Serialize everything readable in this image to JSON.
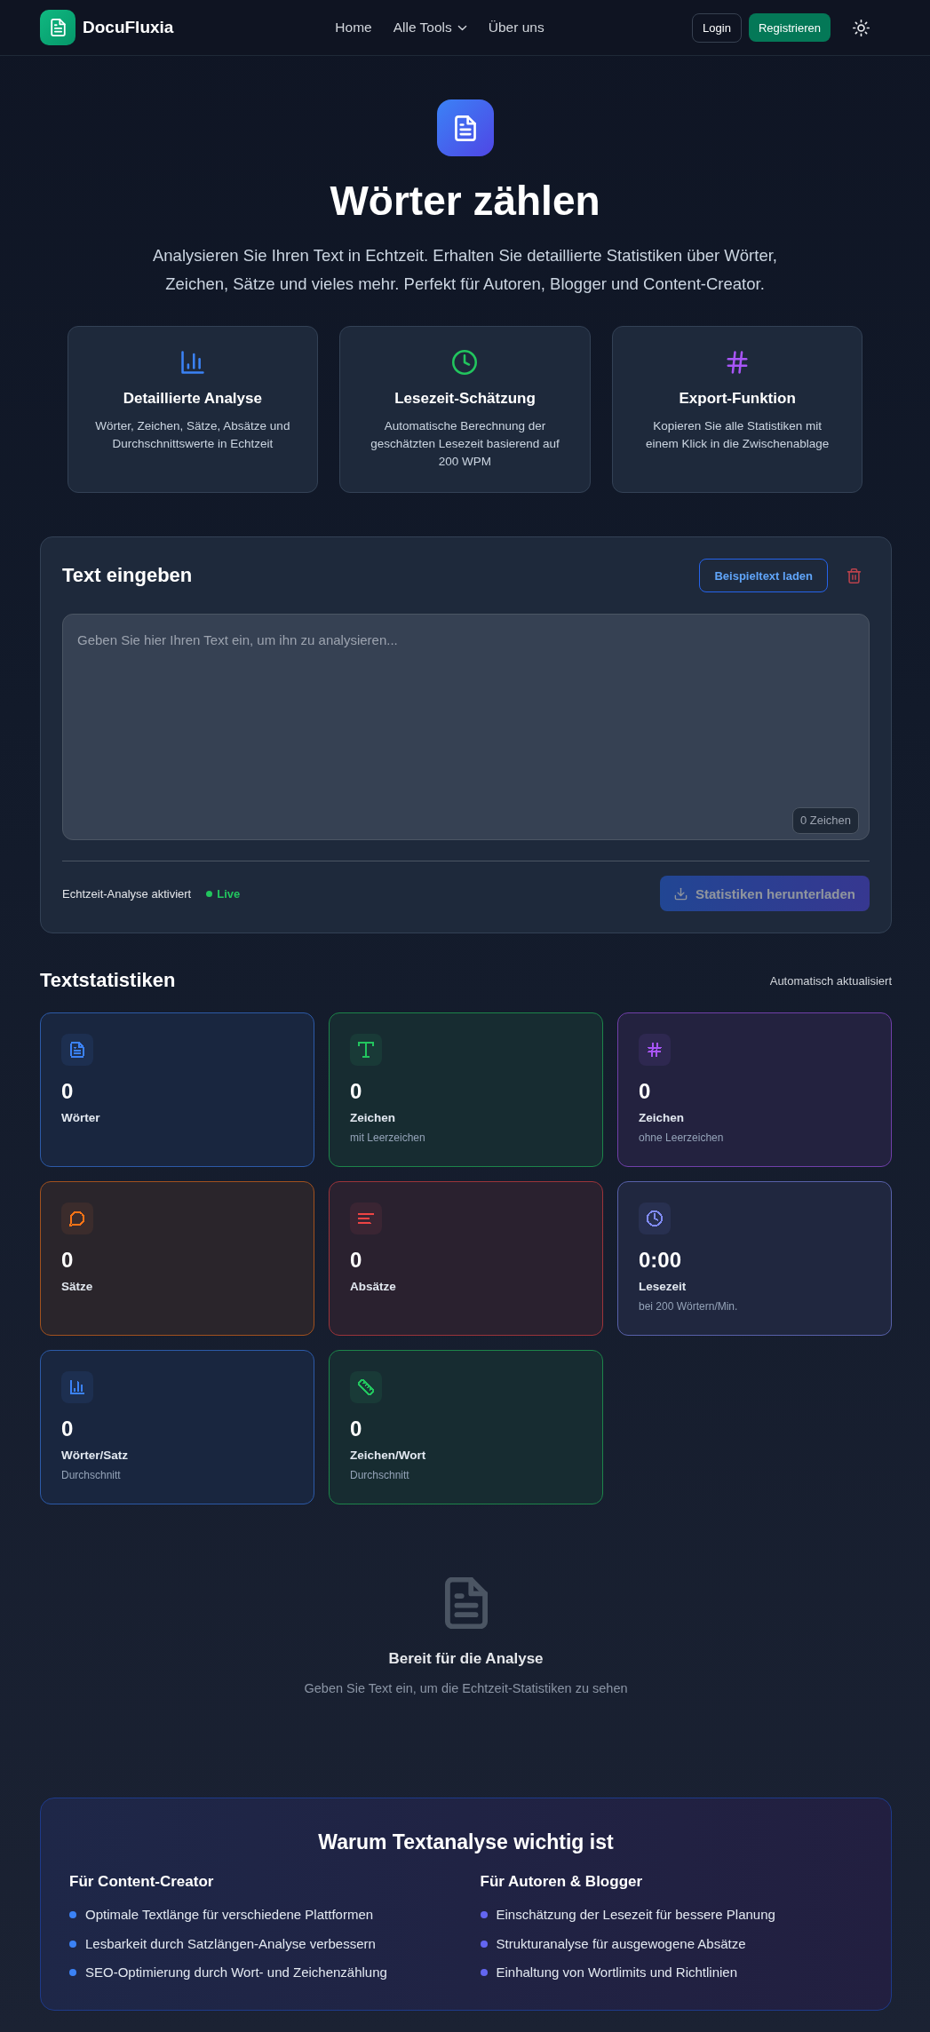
{
  "header": {
    "brand": "DocuFluxia",
    "nav": [
      {
        "label": "Home",
        "dropdown": false
      },
      {
        "label": "Alle Tools",
        "dropdown": true
      },
      {
        "label": "Über uns",
        "dropdown": false
      }
    ],
    "login": "Login",
    "register": "Registrieren"
  },
  "hero": {
    "title": "Wörter zählen",
    "subtitle": "Analysieren Sie Ihren Text in Echtzeit. Erhalten Sie detaillierte Statistiken über Wörter, Zeichen, Sätze und vieles mehr. Perfekt für Autoren, Blogger und Content-Creator.",
    "features": [
      {
        "title": "Detaillierte Analyse",
        "description": "Wörter, Zeichen, Sätze, Absätze und Durchschnittswerte in Echtzeit",
        "color": "#3b82f6"
      },
      {
        "title": "Lesezeit-Schätzung",
        "description": "Automatische Berechnung der geschätzten Lesezeit basierend auf 200 WPM",
        "color": "#22c55e"
      },
      {
        "title": "Export-Funktion",
        "description": "Kopieren Sie alle Statistiken mit einem Klick in die Zwischenablage",
        "color": "#a855f7"
      }
    ]
  },
  "editor": {
    "title": "Text eingeben",
    "sample_button": "Beispieltext laden",
    "placeholder": "Geben Sie hier Ihren Text ein, um ihn zu analysieren...",
    "char_count": "0 Zeichen",
    "status_label": "Echtzeit-Analyse aktiviert",
    "live_label": "Live",
    "download_button": {
      "label": "Statistiken herunterladen",
      "disabled": true
    }
  },
  "statistics": {
    "title": "Textstatistiken",
    "note": "Automatisch aktualisiert",
    "cards": [
      {
        "value": "0",
        "label": "Wörter",
        "color": "#3b82f6"
      },
      {
        "value": "0",
        "label": "Zeichen",
        "sublabel": "mit Leerzeichen",
        "color": "#22c55e"
      },
      {
        "value": "0",
        "label": "Zeichen",
        "sublabel": "ohne Leerzeichen",
        "color": "#a855f7"
      },
      {
        "value": "0",
        "label": "Sätze",
        "color": "#f97316"
      },
      {
        "value": "0",
        "label": "Absätze",
        "color": "#ef4444"
      },
      {
        "value": "0:00",
        "label": "Lesezeit",
        "sublabel": "bei 200 Wörtern/Min.",
        "color": "#818cf8"
      },
      {
        "value": "0",
        "label": "Wörter/Satz",
        "sublabel": "Durchschnitt",
        "color": "#3b82f6"
      },
      {
        "value": "0",
        "label": "Zeichen/Wort",
        "sublabel": "Durchschnitt",
        "color": "#22c55e"
      }
    ]
  },
  "empty_state": {
    "title": "Bereit für die Analyse",
    "text": "Geben Sie Text ein, um die Echtzeit-Statistiken zu sehen"
  },
  "info": {
    "title": "Warum Textanalyse wichtig ist",
    "columns": [
      {
        "title": "Für Content-Creator",
        "color": "#3b82f6",
        "items": [
          "Optimale Textlänge für verschiedene Plattformen",
          "Lesbarkeit durch Satzlängen-Analyse verbessern",
          "SEO-Optimierung durch Wort- und Zeichenzählung"
        ]
      },
      {
        "title": "Für Autoren & Blogger",
        "color": "#6366f1",
        "items": [
          "Einschätzung der Lesezeit für bessere Planung",
          "Strukturanalyse für ausgewogene Absätze",
          "Einhaltung von Wortlimits und Richtlinien"
        ]
      }
    ]
  }
}
